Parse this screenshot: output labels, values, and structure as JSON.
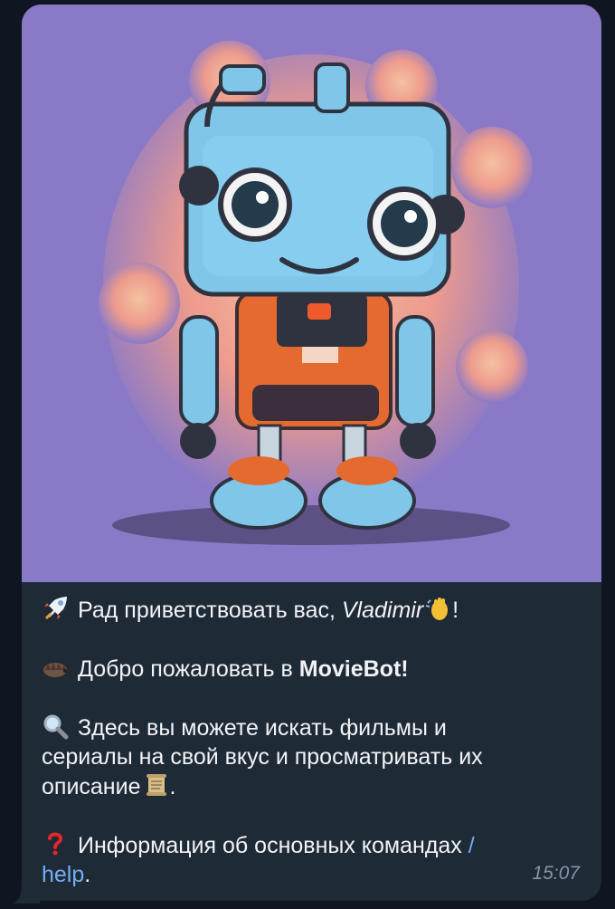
{
  "message": {
    "image_alt": "robot-illustration",
    "line1": {
      "prefix": "Рад приветствовать вас, ",
      "name": "Vladimir",
      "suffix": "!"
    },
    "line2": {
      "prefix": "Добро пожаловать в ",
      "bot_name": "MovieBot!"
    },
    "line3": "Здесь вы можете искать фильмы и",
    "line4": "сериалы на свой вкус и просматривать их",
    "line5": {
      "text": "описание",
      "suffix": "."
    },
    "line6": {
      "prefix": "Информация об основных командах ",
      "command_part1": "/"
    },
    "line7": {
      "command_part2": "help",
      "suffix": "."
    },
    "time": "15:07"
  },
  "icons": {
    "rocket": "rocket-icon",
    "hedgehog": "hedgehog-icon",
    "search": "magnifier-icon",
    "scroll": "scroll-icon",
    "question": "question-mark-icon",
    "wave": "waving-hand-icon"
  }
}
